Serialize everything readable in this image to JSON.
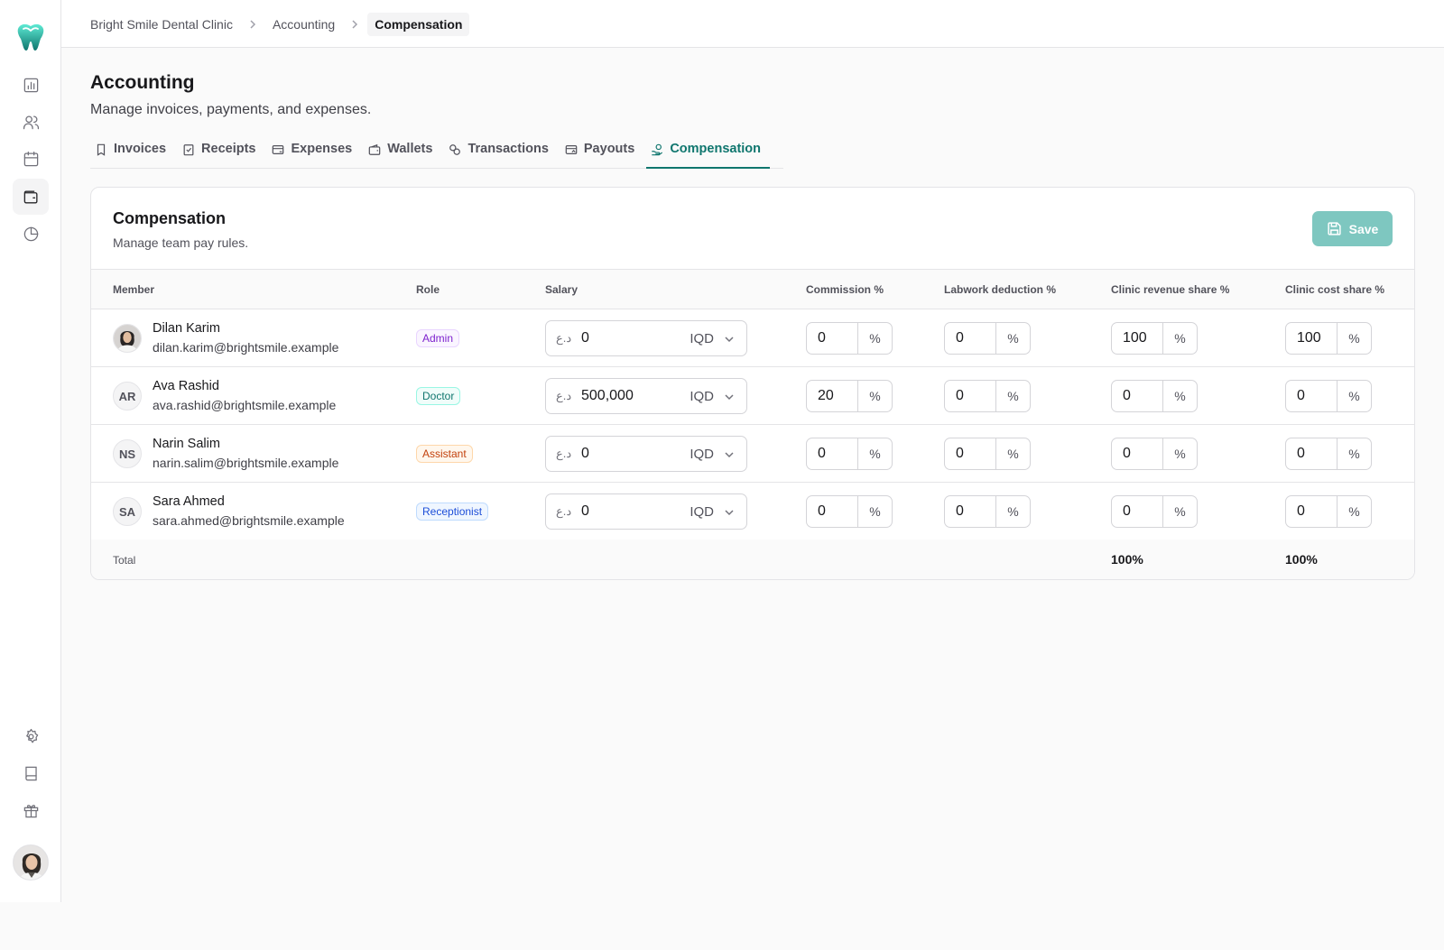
{
  "colors": {
    "accent": "#0f766e",
    "save_button": "#7ec7c0"
  },
  "sidebar": {
    "logo": "tooth-logo",
    "items": [
      {
        "icon": "bar-chart-icon",
        "name": "dashboard"
      },
      {
        "icon": "users-icon",
        "name": "patients"
      },
      {
        "icon": "calendar-icon",
        "name": "appointments"
      },
      {
        "icon": "wallet-icon",
        "name": "accounting",
        "active": true
      },
      {
        "icon": "pie-chart-icon",
        "name": "reports"
      }
    ],
    "bottom_items": [
      {
        "icon": "settings-icon",
        "name": "settings"
      },
      {
        "icon": "book-icon",
        "name": "docs"
      },
      {
        "icon": "gift-icon",
        "name": "referral"
      }
    ]
  },
  "breadcrumb": [
    "Bright Smile Dental Clinic",
    "Accounting",
    "Compensation"
  ],
  "page": {
    "title": "Accounting",
    "subtitle": "Manage invoices, payments, and expenses."
  },
  "tabs": [
    {
      "label": "Invoices",
      "icon": "invoice-icon"
    },
    {
      "label": "Receipts",
      "icon": "receipt-icon"
    },
    {
      "label": "Expenses",
      "icon": "card-icon"
    },
    {
      "label": "Wallets",
      "icon": "wallet-icon"
    },
    {
      "label": "Transactions",
      "icon": "transactions-icon"
    },
    {
      "label": "Payouts",
      "icon": "payout-icon"
    },
    {
      "label": "Compensation",
      "icon": "hand-coins-icon",
      "active": true
    }
  ],
  "card": {
    "title": "Compensation",
    "subtitle": "Manage team pay rules.",
    "save_label": "Save"
  },
  "columns": {
    "member": "Member",
    "role": "Role",
    "salary": "Salary",
    "commission": "Commission %",
    "labwork": "Labwork deduction %",
    "revenue_share": "Clinic revenue share %",
    "cost_share": "Clinic cost share %"
  },
  "members": [
    {
      "initials": "",
      "name": "Dilan Karim",
      "email": "dilan.karim@brightsmile.example",
      "role": "Admin",
      "currency_symbol": "د.ع",
      "salary": "0",
      "currency": "IQD",
      "commission": "0",
      "labwork": "0",
      "revenue_share": "100",
      "cost_share": "100",
      "unit": "%"
    },
    {
      "initials": "AR",
      "name": "Ava Rashid",
      "email": "ava.rashid@brightsmile.example",
      "role": "Doctor",
      "currency_symbol": "د.ع",
      "salary": "500,000",
      "currency": "IQD",
      "commission": "20",
      "labwork": "0",
      "revenue_share": "0",
      "cost_share": "0",
      "unit": "%"
    },
    {
      "initials": "NS",
      "name": "Narin Salim",
      "email": "narin.salim@brightsmile.example",
      "role": "Assistant",
      "currency_symbol": "د.ع",
      "salary": "0",
      "currency": "IQD",
      "commission": "0",
      "labwork": "0",
      "revenue_share": "0",
      "cost_share": "0",
      "unit": "%"
    },
    {
      "initials": "SA",
      "name": "Sara Ahmed",
      "email": "sara.ahmed@brightsmile.example",
      "role": "Receptionist",
      "currency_symbol": "د.ع",
      "salary": "0",
      "currency": "IQD",
      "commission": "0",
      "labwork": "0",
      "revenue_share": "0",
      "cost_share": "0",
      "unit": "%"
    }
  ],
  "totals": {
    "label": "Total",
    "revenue_share": "100%",
    "cost_share": "100%"
  }
}
